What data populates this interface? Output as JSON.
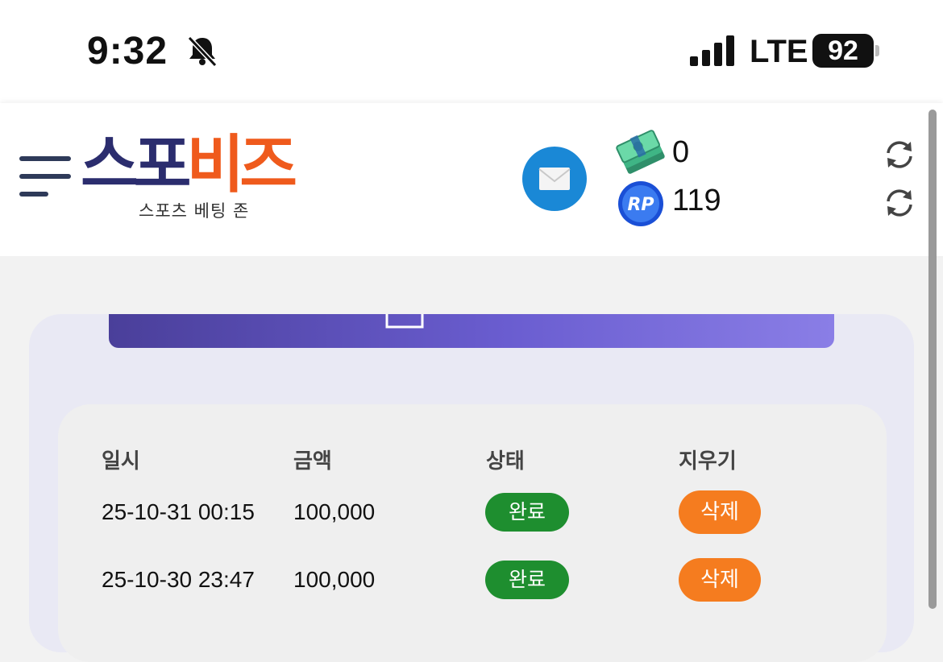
{
  "status_bar": {
    "time": "9:32",
    "network": "LTE",
    "battery": "92",
    "icons": [
      "bell-slash-icon",
      "signal-bars-icon",
      "battery-icon"
    ]
  },
  "header": {
    "logo": {
      "part1": "스포",
      "part2": "비즈",
      "subtitle": "스포츠 베팅 존"
    },
    "money_balance": "0",
    "rolling_points": "119",
    "icons": [
      "menu-icon",
      "mail-icon",
      "cash-icon",
      "rp-coin-icon",
      "refresh-icon"
    ]
  },
  "colors": {
    "logo_navy": "#2b2d6e",
    "logo_orange": "#ef5a1c",
    "mail_blue": "#1a88d6",
    "status_green": "#1e8e2f",
    "delete_orange": "#f57c1f",
    "button_purple": "#6a5dd0"
  },
  "table": {
    "headers": [
      "일시",
      "금액",
      "상태",
      "지우기"
    ],
    "rows": [
      {
        "datetime": "25-10-31 00:15",
        "amount": "100,000",
        "status": "완료",
        "action": "삭제"
      },
      {
        "datetime": "25-10-30 23:47",
        "amount": "100,000",
        "status": "완료",
        "action": "삭제"
      }
    ]
  }
}
